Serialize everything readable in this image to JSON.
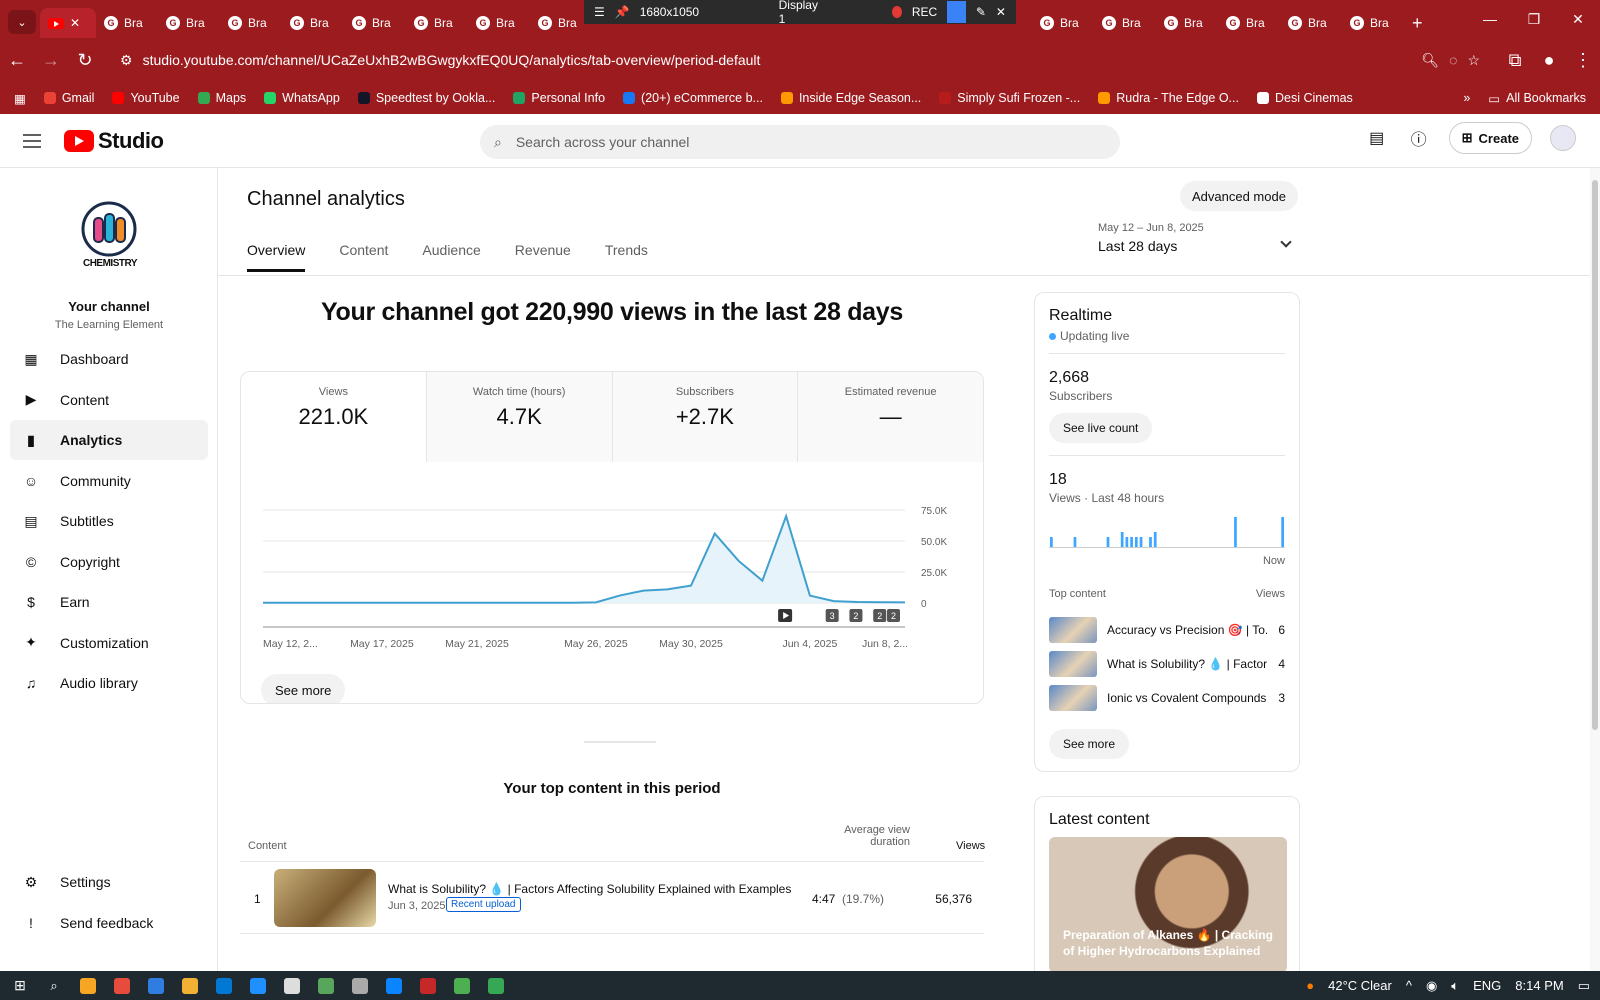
{
  "browser": {
    "tabs": [
      "Bra",
      "Bra",
      "Bra",
      "Bra",
      "Bra",
      "Bra",
      "Bra",
      "Bra"
    ],
    "tabs_right": [
      "Bra",
      "Bra",
      "Bra",
      "Bra",
      "Bra",
      "Bra"
    ],
    "overlay": {
      "resolution": "1680x1050",
      "display": "Display 1",
      "rec": "REC"
    },
    "url": "studio.youtube.com/channel/UCaZeUxhB2wBGwgykxfEQ0UQ/analytics/tab-overview/period-default",
    "bookmarks": [
      {
        "label": "Gmail",
        "color": "#ea4335"
      },
      {
        "label": "YouTube",
        "color": "#ff0000"
      },
      {
        "label": "Maps",
        "color": "#34a853"
      },
      {
        "label": "WhatsApp",
        "color": "#25d366"
      },
      {
        "label": "Speedtest by Ookla...",
        "color": "#141526"
      },
      {
        "label": "Personal Info",
        "color": "#1fa463"
      },
      {
        "label": "(20+) eCommerce b...",
        "color": "#1877f2"
      },
      {
        "label": "Inside Edge Season...",
        "color": "#ff9900"
      },
      {
        "label": "Simply Sufi Frozen -...",
        "color": "#b71c1c"
      },
      {
        "label": "Rudra - The Edge O...",
        "color": "#ff9900"
      },
      {
        "label": "Desi Cinemas",
        "color": "#ffffff"
      }
    ],
    "all_bookmarks": "All Bookmarks"
  },
  "header": {
    "logo_text": "Studio",
    "search_placeholder": "Search across your channel",
    "create_label": "Create"
  },
  "sidebar": {
    "channel_logo_text": "CHEMISTRY",
    "your_channel": "Your channel",
    "channel_name": "The Learning Element",
    "items": [
      {
        "label": "Dashboard",
        "icon": "dashboard-icon"
      },
      {
        "label": "Content",
        "icon": "content-icon"
      },
      {
        "label": "Analytics",
        "icon": "analytics-icon",
        "active": true
      },
      {
        "label": "Community",
        "icon": "community-icon"
      },
      {
        "label": "Subtitles",
        "icon": "subtitles-icon"
      },
      {
        "label": "Copyright",
        "icon": "copyright-icon"
      },
      {
        "label": "Earn",
        "icon": "earn-icon"
      },
      {
        "label": "Customization",
        "icon": "customization-icon"
      },
      {
        "label": "Audio library",
        "icon": "audio-library-icon"
      }
    ],
    "bottom": [
      {
        "label": "Settings",
        "icon": "gear-icon"
      },
      {
        "label": "Send feedback",
        "icon": "feedback-icon"
      }
    ]
  },
  "main": {
    "title": "Channel analytics",
    "advanced_mode": "Advanced mode",
    "tabs": [
      "Overview",
      "Content",
      "Audience",
      "Revenue",
      "Trends"
    ],
    "period_range": "May 12 – Jun 8, 2025",
    "period_label": "Last 28 days",
    "headline": "Your channel got 220,990 views in the last 28 days",
    "metrics": [
      {
        "label": "Views",
        "value": "221.0K"
      },
      {
        "label": "Watch time (hours)",
        "value": "4.7K"
      },
      {
        "label": "Subscribers",
        "value": "+2.7K"
      },
      {
        "label": "Estimated revenue",
        "value": "—"
      }
    ],
    "see_more": "See more",
    "top_content_title": "Your top content in this period",
    "table_headers": {
      "content": "Content",
      "avg_line1": "Average view",
      "avg_line2": "duration",
      "views": "Views"
    },
    "top_row": {
      "rank": "1",
      "title": "What is Solubility? 💧 | Factors Affecting Solubility Explained with Examples",
      "date": "Jun 3, 2025",
      "badge": "Recent upload",
      "avg_duration": "4:47",
      "avg_pct": "(19.7%)",
      "views": "56,376"
    }
  },
  "chart_data": {
    "type": "line",
    "x_tick_labels": [
      "May 12, 2...",
      "May 17, 2025",
      "May 21, 2025",
      "May 26, 2025",
      "May 30, 2025",
      "Jun 4, 2025",
      "Jun 8, 2..."
    ],
    "y_tick_labels": [
      "75.0K",
      "50.0K",
      "25.0K",
      "0"
    ],
    "ylim": [
      0,
      75000
    ],
    "x": [
      "May 12",
      "May 13",
      "May 14",
      "May 15",
      "May 16",
      "May 17",
      "May 18",
      "May 19",
      "May 20",
      "May 21",
      "May 22",
      "May 23",
      "May 24",
      "May 25",
      "May 26",
      "May 27",
      "May 28",
      "May 29",
      "May 30",
      "May 31",
      "Jun 1",
      "Jun 2",
      "Jun 3",
      "Jun 4",
      "Jun 5",
      "Jun 6",
      "Jun 7",
      "Jun 8"
    ],
    "values": [
      200,
      200,
      200,
      200,
      200,
      200,
      200,
      200,
      200,
      200,
      200,
      200,
      200,
      200,
      500,
      6000,
      10000,
      11000,
      14000,
      56000,
      34000,
      18000,
      70000,
      6000,
      1500,
      800,
      600,
      500
    ],
    "markers": [
      "3",
      "2",
      "2",
      "2"
    ],
    "grid": true
  },
  "realtime": {
    "title": "Realtime",
    "status": "Updating live",
    "subscribers": "2,668",
    "subscribers_label": "Subscribers",
    "see_live_count": "See live count",
    "views": "18",
    "views_label": "Views · Last 48 hours",
    "now_label": "Now",
    "bars": [
      2,
      0,
      0,
      0,
      0,
      2,
      0,
      0,
      0,
      0,
      0,
      0,
      2,
      0,
      0,
      3,
      2,
      2,
      2,
      2,
      0,
      2,
      3,
      0,
      0,
      0,
      0,
      0,
      0,
      0,
      0,
      0,
      0,
      0,
      0,
      0,
      0,
      0,
      0,
      6,
      0,
      0,
      0,
      0,
      0,
      0,
      0,
      0,
      0,
      6
    ],
    "top_content_label": "Top content",
    "views_col": "Views",
    "top_items": [
      {
        "title": "Accuracy vs Precision 🎯 | To...",
        "views": "6"
      },
      {
        "title": "What is Solubility? 💧 | Factor...",
        "views": "4"
      },
      {
        "title": "Ionic vs Covalent Compounds...",
        "views": "3"
      }
    ],
    "see_more": "See more"
  },
  "latest": {
    "title": "Latest content",
    "caption": "Preparation of Alkanes 🔥 | Cracking of Higher Hydrocarbons Explained"
  },
  "taskbar": {
    "weather": "42°C  Clear",
    "lang": "ENG",
    "time": "8:14 PM",
    "apps": [
      "#f6a623",
      "#e64b3c",
      "#2f7de1",
      "#f2b134",
      "#0078d4",
      "#1e90ff",
      "#dddddd",
      "#58a55c",
      "#aaaaaa",
      "#0a84ff",
      "#c62828",
      "#4caf50",
      "#34a853"
    ]
  },
  "colors": {
    "brand_red": "#ff0000",
    "chrome_red": "#9c1b1f",
    "line": "#3fa0cf",
    "area": "#e6f3fa"
  }
}
